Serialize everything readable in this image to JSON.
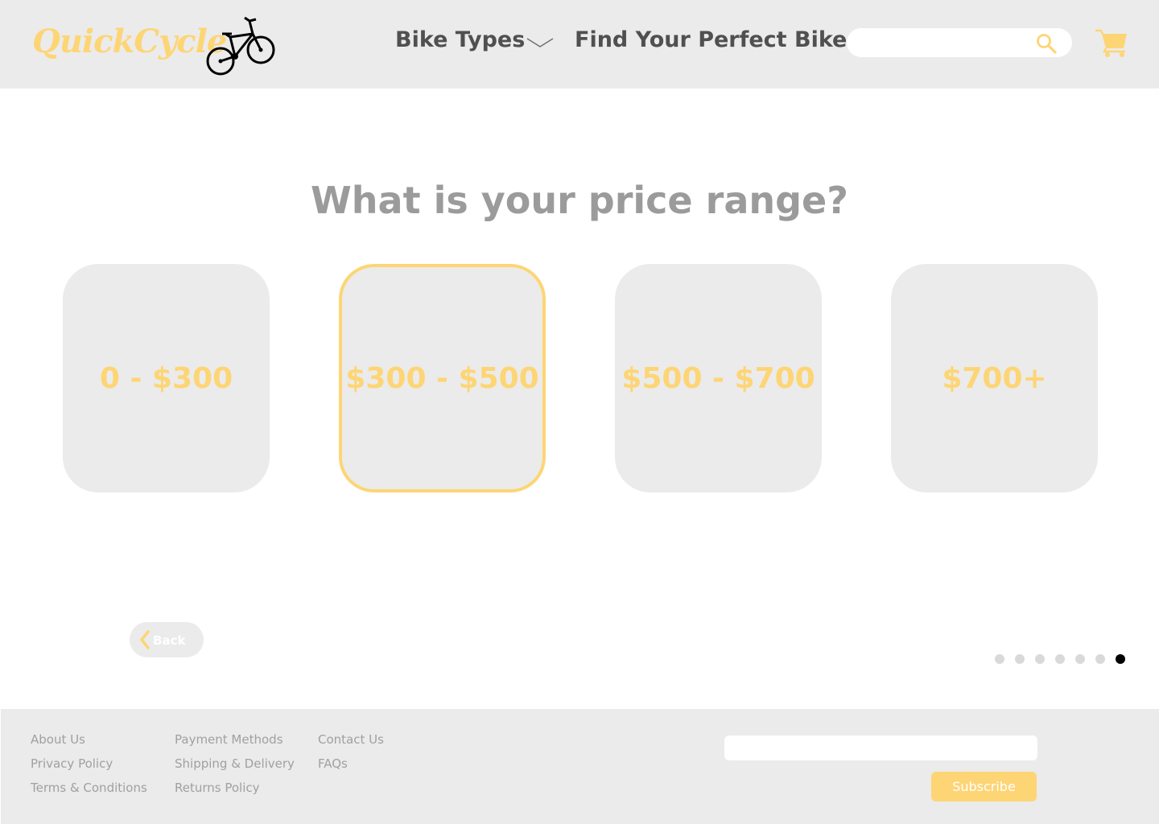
{
  "header": {
    "logo_text": "QuickCycle",
    "nav": {
      "bike_types": "Bike Types",
      "find_perfect_bike": "Find Your Perfect Bike"
    },
    "search": {
      "placeholder": "",
      "value": ""
    },
    "icons": [
      "bicycle-logo",
      "chevron-down-icon",
      "search-icon",
      "cart-icon"
    ]
  },
  "main": {
    "question": "What is your price range?",
    "options": [
      {
        "label": "0 - $300",
        "selected": false
      },
      {
        "label": "$300 - $500",
        "selected": true
      },
      {
        "label": "$500 - $700",
        "selected": false
      },
      {
        "label": "$700+",
        "selected": false
      }
    ],
    "back_label": "Back",
    "progress": {
      "total_steps": 7,
      "current_step": 7
    }
  },
  "footer": {
    "columns": [
      [
        "About Us",
        "Privacy Policy",
        "Terms & Conditions"
      ],
      [
        "Payment Methods",
        "Shipping & Delivery",
        "Returns Policy"
      ],
      [
        "Contact Us",
        "FAQs"
      ]
    ],
    "newsletter": {
      "placeholder": "",
      "value": ""
    },
    "subscribe_label": "Subscribe"
  },
  "colors": {
    "accent": "#fdd575",
    "panel": "#ebebeb",
    "heading": "#9b9b9b",
    "nav_text": "#505050",
    "footer_text": "#a0a0a0",
    "dot_inactive": "#d9d9d9",
    "dot_active": "#000000"
  }
}
